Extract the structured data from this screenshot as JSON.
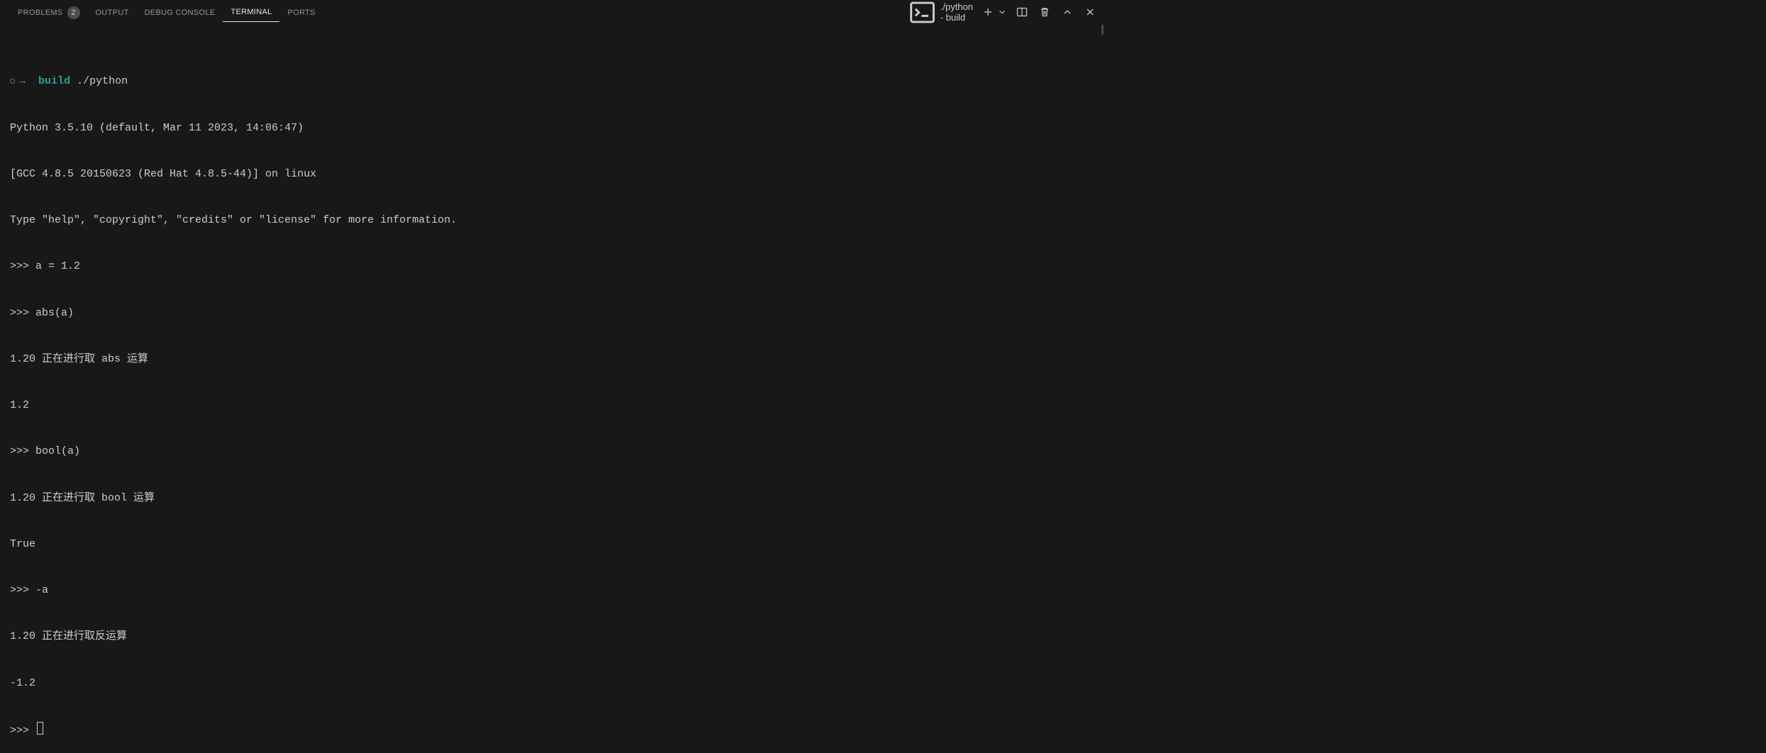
{
  "tabs": {
    "problems": {
      "label": "PROBLEMS",
      "badge": "2"
    },
    "output": {
      "label": "OUTPUT"
    },
    "debug": {
      "label": "DEBUG CONSOLE"
    },
    "terminal": {
      "label": "TERMINAL"
    },
    "ports": {
      "label": "PORTS"
    }
  },
  "toolbar": {
    "terminal_name": "./python - build"
  },
  "terminal": {
    "prompt_arrow": "→",
    "prompt_path": "build",
    "command": "./python",
    "lines": [
      "Python 3.5.10 (default, Mar 11 2023, 14:06:47) ",
      "[GCC 4.8.5 20150623 (Red Hat 4.8.5-44)] on linux",
      "Type \"help\", \"copyright\", \"credits\" or \"license\" for more information.",
      ">>> a = 1.2",
      ">>> abs(a)",
      "1.20 正在进行取 abs 运算",
      "1.2",
      ">>> bool(a)",
      "1.20 正在进行取 bool 运算",
      "True",
      ">>> -a",
      "1.20 正在进行取反运算",
      "-1.2",
      ">>> "
    ]
  }
}
